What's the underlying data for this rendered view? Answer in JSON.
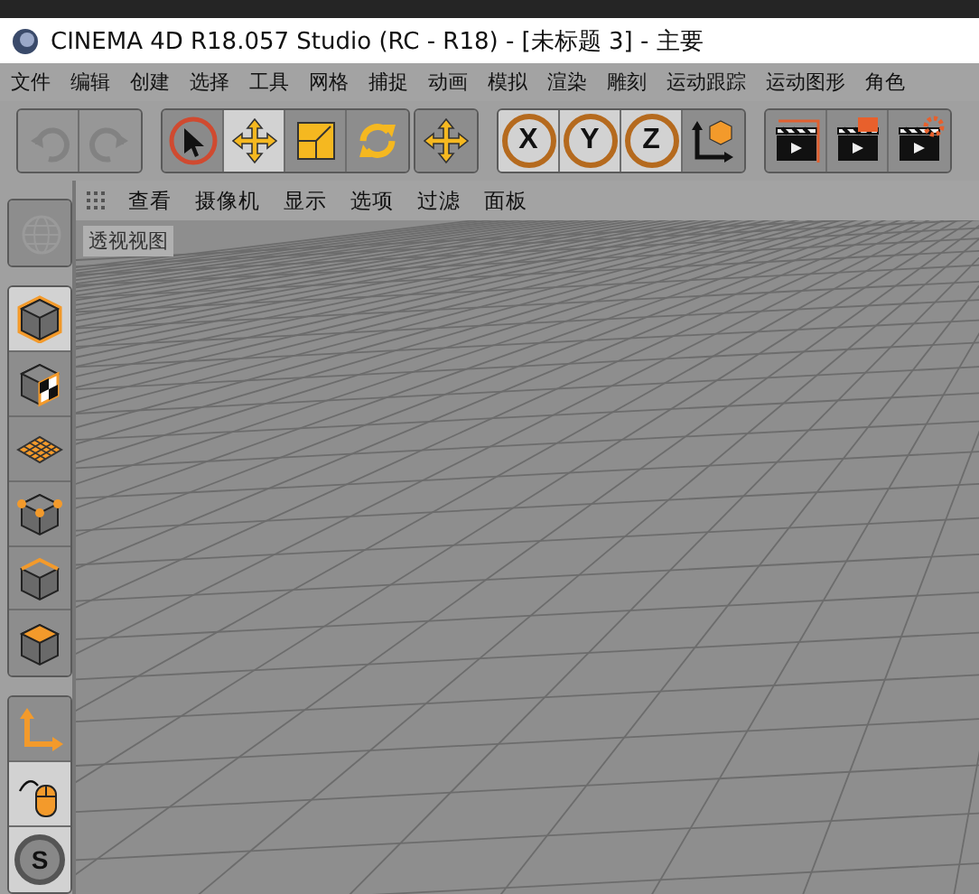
{
  "window": {
    "title": "CINEMA 4D R18.057 Studio (RC - R18) - [未标题 3] - 主要"
  },
  "menu": [
    "文件",
    "编辑",
    "创建",
    "选择",
    "工具",
    "网格",
    "捕捉",
    "动画",
    "模拟",
    "渲染",
    "雕刻",
    "运动跟踪",
    "运动图形",
    "角色"
  ],
  "toolbar": [
    {
      "buttons": [
        {
          "kind": "undo",
          "selected": false,
          "disabled": true
        },
        {
          "kind": "redo",
          "selected": false,
          "disabled": true
        }
      ]
    },
    {
      "buttons": [
        {
          "kind": "select",
          "selected": false,
          "disabled": false
        },
        {
          "kind": "move",
          "selected": true,
          "disabled": false
        },
        {
          "kind": "scale",
          "selected": false,
          "disabled": false
        },
        {
          "kind": "rotate",
          "selected": false,
          "disabled": false
        }
      ]
    },
    {
      "buttons": [
        {
          "kind": "move",
          "selected": false,
          "disabled": false
        }
      ]
    },
    {
      "buttons": [
        {
          "kind": "axis",
          "label": "X",
          "selected": true,
          "disabled": false
        },
        {
          "kind": "axis",
          "label": "Y",
          "selected": true,
          "disabled": false
        },
        {
          "kind": "axis",
          "label": "Z",
          "selected": true,
          "disabled": false
        },
        {
          "kind": "coordinates",
          "selected": false,
          "disabled": false
        }
      ]
    },
    {
      "buttons": [
        {
          "kind": "render-view",
          "selected": false,
          "disabled": false
        },
        {
          "kind": "render",
          "selected": false,
          "disabled": false
        },
        {
          "kind": "render-settings",
          "selected": false,
          "disabled": false
        }
      ]
    }
  ],
  "viewport": {
    "menu": [
      "查看",
      "摄像机",
      "显示",
      "选项",
      "过滤",
      "面板"
    ],
    "label": "透视视图"
  },
  "sidebar": [
    {
      "tools": [
        {
          "kind": "globe",
          "selected": false
        }
      ]
    },
    {
      "tools": [
        {
          "kind": "model",
          "selected": true
        },
        {
          "kind": "texture",
          "selected": false
        },
        {
          "kind": "workplane",
          "selected": false
        },
        {
          "kind": "points",
          "selected": false
        },
        {
          "kind": "edges",
          "selected": false
        },
        {
          "kind": "polygons",
          "selected": false
        }
      ]
    },
    {
      "tools": [
        {
          "kind": "axis-mode",
          "selected": false
        },
        {
          "kind": "tweak",
          "selected": true
        },
        {
          "kind": "snap",
          "label": "S",
          "selected": true
        }
      ]
    }
  ]
}
